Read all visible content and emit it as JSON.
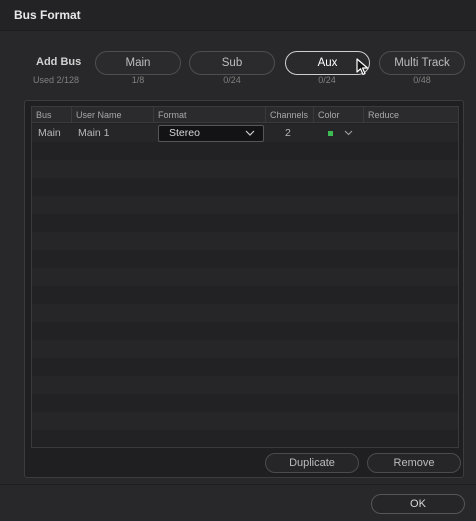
{
  "dialog": {
    "title": "Bus Format"
  },
  "add_bus": {
    "label": "Add Bus",
    "used": "Used 2/128",
    "buttons": [
      {
        "label": "Main",
        "count": "1/8",
        "active": false
      },
      {
        "label": "Sub",
        "count": "0/24",
        "active": false
      },
      {
        "label": "Aux",
        "count": "0/24",
        "active": true
      },
      {
        "label": "Multi Track",
        "count": "0/48",
        "active": false
      }
    ]
  },
  "table": {
    "columns": [
      "Bus",
      "User Name",
      "Format",
      "Channels",
      "Color",
      "Reduce"
    ],
    "rows": [
      {
        "bus": "Main",
        "user_name": "Main 1",
        "format": "Stereo",
        "channels": "2",
        "color": "#3dbb55",
        "reduce": ""
      }
    ]
  },
  "actions": {
    "duplicate": "Duplicate",
    "remove": "Remove"
  },
  "footer": {
    "ok": "OK"
  },
  "icons": {
    "cursor": "arrow-cursor-icon",
    "chevron": "chevron-down-icon"
  }
}
